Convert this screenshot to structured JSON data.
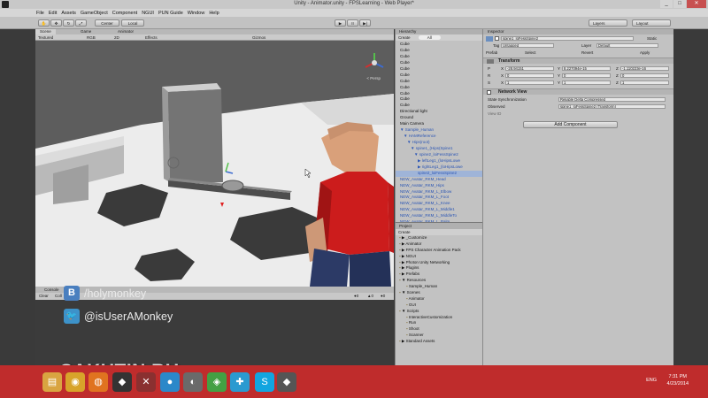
{
  "window": {
    "title": "Unity - Animator.unity - FPSLearning - Web Player*",
    "buttons": [
      "_",
      "□",
      "✕"
    ]
  },
  "menu": [
    "File",
    "Edit",
    "Assets",
    "GameObject",
    "Component",
    "NGUI",
    "PUN Guide",
    "Window",
    "Help"
  ],
  "toolbar": {
    "center_label": "Center",
    "local_label": "Local",
    "play": "▶",
    "pause": "II",
    "step": "▶|",
    "layers_label": "Layers",
    "layout_label": "Layout"
  },
  "scene": {
    "tabs": [
      "Scene",
      "Game",
      "Animator"
    ],
    "bar": {
      "shading": "Textured",
      "render": "RGB",
      "mode": "2D",
      "effects": "Effects",
      "gizmos": "Gizmos"
    },
    "persp_label": "< Persp"
  },
  "console": {
    "tab": "Console",
    "clear": "Clear",
    "collapse": "Coll"
  },
  "social": {
    "vk_icon": "B",
    "vk_text": "/holymonkey",
    "twitter_text": "@isUserAMonkey"
  },
  "watermark": "SAKUTIN.RU",
  "hierarchy": {
    "tab": "Hierarchy",
    "create": "Create",
    "search": "All",
    "items": [
      {
        "label": "Cube",
        "indent": 0,
        "blue": false
      },
      {
        "label": "Cube",
        "indent": 0,
        "blue": false
      },
      {
        "label": "Cube",
        "indent": 0,
        "blue": false
      },
      {
        "label": "Cube",
        "indent": 0,
        "blue": false
      },
      {
        "label": "Cube",
        "indent": 0,
        "blue": false
      },
      {
        "label": "Cube",
        "indent": 0,
        "blue": false
      },
      {
        "label": "Cube",
        "indent": 0,
        "blue": false
      },
      {
        "label": "Cube",
        "indent": 0,
        "blue": false
      },
      {
        "label": "Cube",
        "indent": 0,
        "blue": false
      },
      {
        "label": "Cube",
        "indent": 0,
        "blue": false
      },
      {
        "label": "Cube",
        "indent": 0,
        "blue": false
      },
      {
        "label": "Directional light",
        "indent": 0,
        "blue": false
      },
      {
        "label": "Ground",
        "indent": 0,
        "blue": false
      },
      {
        "label": "Main Camera",
        "indent": 0,
        "blue": false
      },
      {
        "label": "▼ Sample_Human",
        "indent": 0,
        "blue": true
      },
      {
        "label": "▼ HAMReference",
        "indent": 1,
        "blue": true
      },
      {
        "label": "▼ Hips(root)",
        "indent": 2,
        "blue": true
      },
      {
        "label": "▼ spine1_(Hips(Spine1",
        "indent": 3,
        "blue": true
      },
      {
        "label": "▼ spine2_loiFessSpine2",
        "indent": 4,
        "blue": true
      },
      {
        "label": "▶ leftLeg1_(loHipsLowe",
        "indent": 5,
        "blue": true
      },
      {
        "label": "▶ rightLeg1_(loHipsLowe",
        "indent": 5,
        "blue": true
      },
      {
        "label": "spine2_loiFessSpine2",
        "indent": 5,
        "blue": true,
        "selected": true
      },
      {
        "label": "NEW_Avatar_RKM_Head",
        "indent": 0,
        "blue": true
      },
      {
        "label": "NEW_Avatar_RKM_Hips",
        "indent": 0,
        "blue": true
      },
      {
        "label": "NEW_Avatar_RKM_L_Elbow",
        "indent": 0,
        "blue": true
      },
      {
        "label": "NEW_Avatar_RKM_L_Foot",
        "indent": 0,
        "blue": true
      },
      {
        "label": "NEW_Avatar_RKM_L_Knee",
        "indent": 0,
        "blue": true
      },
      {
        "label": "NEW_Avatar_RKM_L_Middle1",
        "indent": 0,
        "blue": true
      },
      {
        "label": "NEW_Avatar_RKM_L_MiddleTo",
        "indent": 0,
        "blue": true
      },
      {
        "label": "NEW_Avatar_RKM_L_Palm",
        "indent": 0,
        "blue": true
      },
      {
        "label": "NEW_Avatar_RKM_L_Pinky1",
        "indent": 0,
        "blue": true
      },
      {
        "label": "NEW_Avatar_RKM_L_Pinky3",
        "indent": 0,
        "blue": true
      }
    ]
  },
  "project": {
    "tab": "Project",
    "create": "Create",
    "items": [
      {
        "label": "▶ _Customize",
        "indent": 0
      },
      {
        "label": "▶ Animator",
        "indent": 0
      },
      {
        "label": "▶ FPS Character Animation Pack",
        "indent": 0
      },
      {
        "label": "▶ NGUI",
        "indent": 0
      },
      {
        "label": "▶ Photon Unity Networking",
        "indent": 0
      },
      {
        "label": "▶ Plugins",
        "indent": 0
      },
      {
        "label": "▶ Prefabs",
        "indent": 0
      },
      {
        "label": "▼ Resources",
        "indent": 0
      },
      {
        "label": "Sample_Human",
        "indent": 1
      },
      {
        "label": "▼ Scenes",
        "indent": 0
      },
      {
        "label": "Animator",
        "indent": 1
      },
      {
        "label": "GUI",
        "indent": 1
      },
      {
        "label": "▼ Scripts",
        "indent": 0
      },
      {
        "label": "InteractiveCustomization",
        "indent": 1
      },
      {
        "label": "Run",
        "indent": 1
      },
      {
        "label": "Shoot",
        "indent": 1
      },
      {
        "label": "Scanner",
        "indent": 1
      },
      {
        "label": "▶ Standard Assets",
        "indent": 0
      }
    ]
  },
  "inspector": {
    "tab": "Inspector",
    "object_name": "spine1_loFessSpine2",
    "static_label": "Static",
    "tag_label": "Tag",
    "tag_value": "Untagged",
    "layer_label": "Layer",
    "layer_value": "Default",
    "prefab_label": "Prefab",
    "prefab_buttons": [
      "Select",
      "Revert",
      "Apply"
    ],
    "transform": {
      "title": "Transform",
      "rows": [
        {
          "label": "P",
          "x": "-28.94151",
          "y": "8.227094e-15",
          "z": "-1.110223e-16"
        },
        {
          "label": "R",
          "x": "0",
          "y": "0",
          "z": "0"
        },
        {
          "label": "S",
          "x": "1",
          "y": "1",
          "z": "1"
        }
      ]
    },
    "network_view": {
      "title": "Network View",
      "state_label": "State Synchronization",
      "state_value": "Reliable Delta Compressed",
      "observed_label": "Observed",
      "observed_value": "spine1_loFessSpine2 (Transform)",
      "view_id_label": "View ID"
    },
    "add_component": "Add Component"
  },
  "taskbar": {
    "icons": [
      {
        "name": "file-explorer-icon",
        "glyph": "▤",
        "color": "#d9a441"
      },
      {
        "name": "chrome-icon",
        "glyph": "◉",
        "color": "#d8a32a"
      },
      {
        "name": "firefox-icon",
        "glyph": "◍",
        "color": "#e07320"
      },
      {
        "name": "unity-icon",
        "glyph": "◆",
        "color": "#333333"
      },
      {
        "name": "xnview-icon",
        "glyph": "✕",
        "color": "#8a3030"
      },
      {
        "name": "app-icon-circle",
        "glyph": "●",
        "color": "#2b88c9"
      },
      {
        "name": "monodevelop-icon",
        "glyph": "◐",
        "color": "#6a6a6a"
      },
      {
        "name": "winamp-icon",
        "glyph": "◈",
        "color": "#43a043"
      },
      {
        "name": "network-app-icon",
        "glyph": "✚",
        "color": "#2a9ad0"
      },
      {
        "name": "skype-icon",
        "glyph": "S",
        "color": "#12a5e0"
      },
      {
        "name": "unity-alt-icon",
        "glyph": "◆",
        "color": "#555555"
      }
    ],
    "lang": "ENG",
    "time": "7:31 PM",
    "date": "4/23/2014"
  },
  "colors": {
    "taskbar": "#bf2c2c",
    "editor_bg": "#c2c2c2",
    "hierarchy_prefab_text": "#2a55b5"
  }
}
